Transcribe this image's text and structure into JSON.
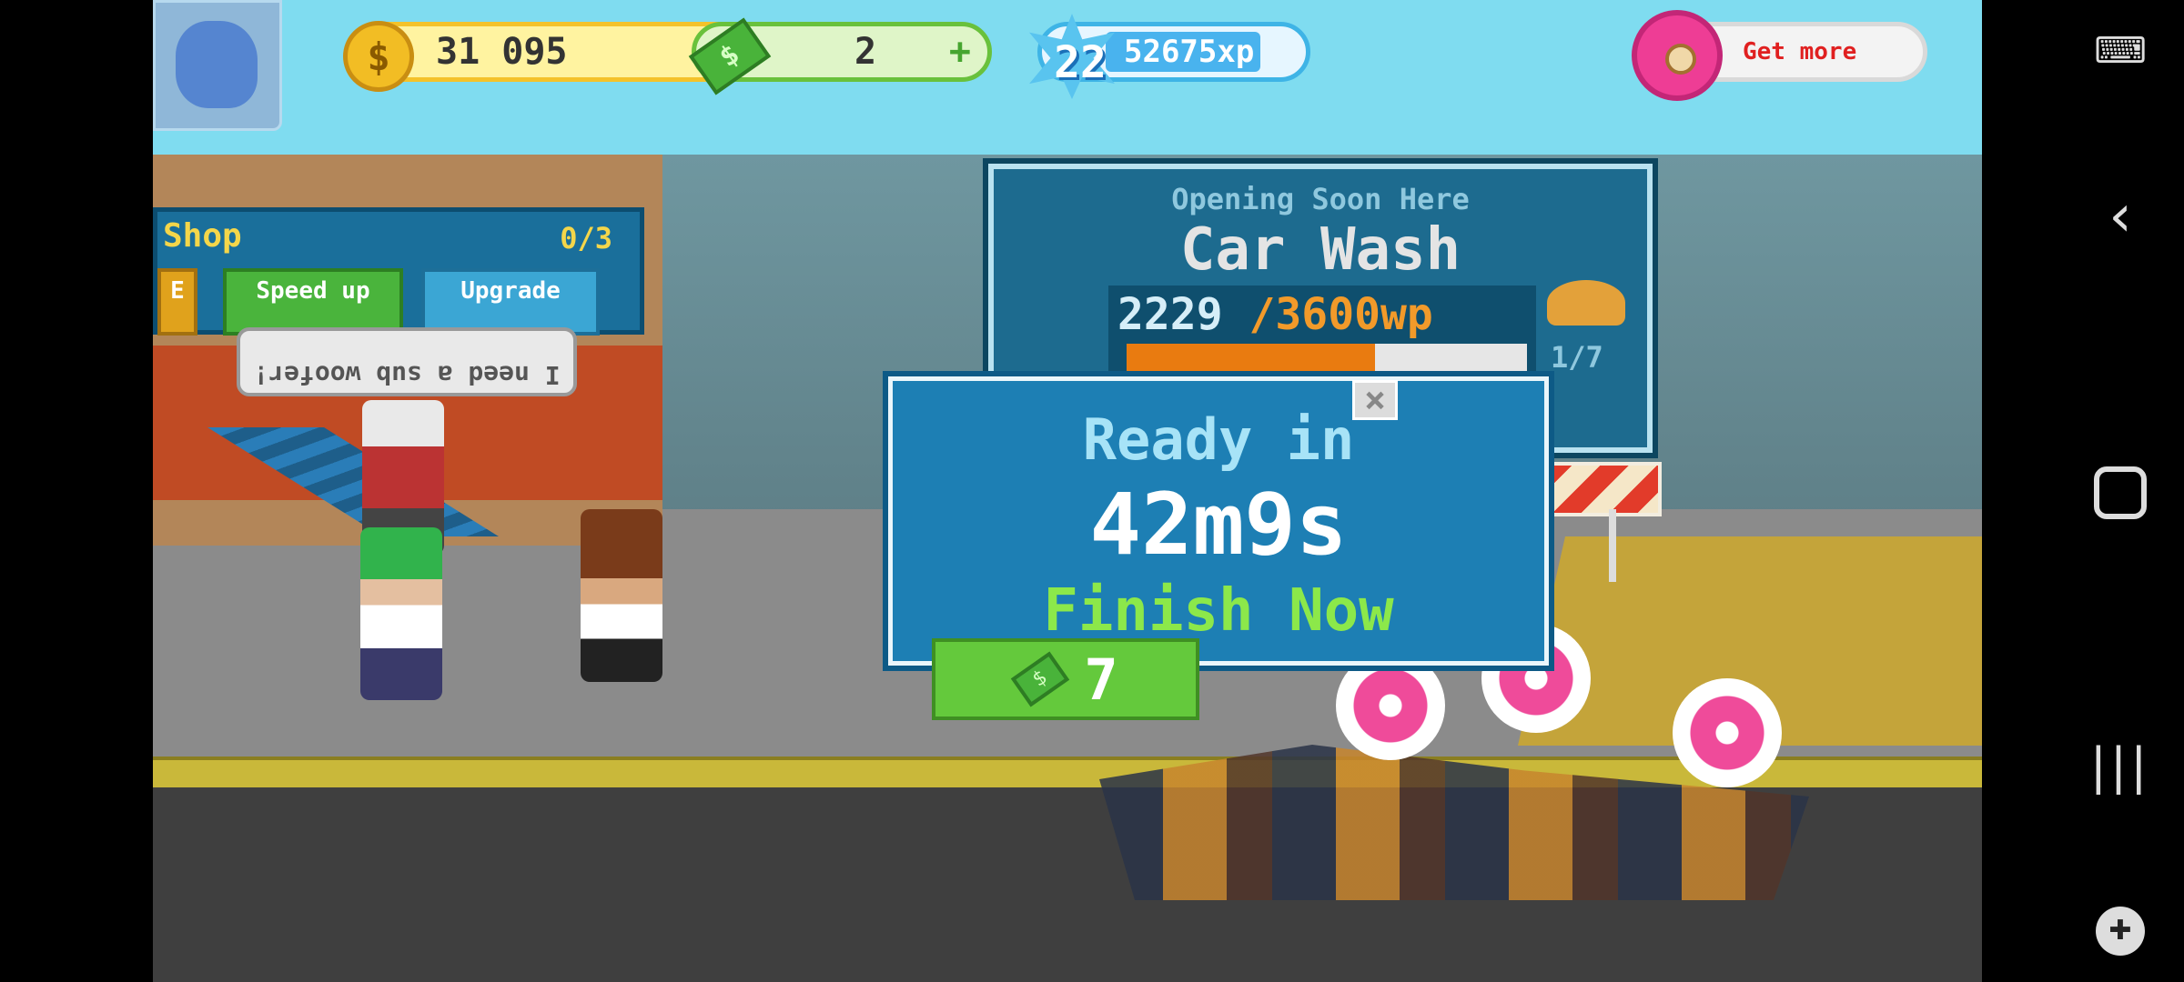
{
  "hud": {
    "coins": "31 095",
    "cash": "2",
    "level": "22",
    "xp": "52675xp",
    "donut_button": "Get more",
    "xp_progress": 0.5
  },
  "shop": {
    "title": "Shop",
    "count": "0/3",
    "stub_button": "E",
    "speed_up": "Speed up",
    "upgrade": "Upgrade",
    "speech": "I need a sub woofer!"
  },
  "carwash": {
    "subtitle": "Opening Soon Here",
    "title": "Car Wash",
    "progress_current": "2229",
    "progress_goal": "/3600wp",
    "progress_fraction": 0.62,
    "steps": "1/7"
  },
  "popup": {
    "ready": "Ready in",
    "time": "42m9s",
    "finish": "Finish Now",
    "cost": "7",
    "close": "×"
  },
  "icons": {
    "coin": "$",
    "cash": "$",
    "plus": "+"
  },
  "colors": {
    "sky": "#7fdcf0",
    "popup": "#1d7fb4",
    "finish_green": "#64c93c",
    "gold": "#f2bd24"
  }
}
